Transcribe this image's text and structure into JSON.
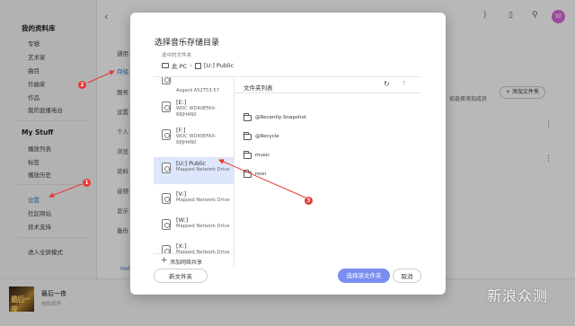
{
  "sidebar": {
    "library_heading": "我的资料库",
    "library_items": [
      "专辑",
      "艺术家",
      "曲目",
      "作曲家",
      "作品",
      "我的直播电台"
    ],
    "mystuff_heading": "My Stuff",
    "mystuff_items": [
      "播放列表",
      "标签",
      "播放历史"
    ],
    "settings_label": "设置",
    "community_label": "社区网站",
    "support_label": "技术支持",
    "fullscreen_label": "进入全屏模式"
  },
  "player": {
    "track_title": "最后一夜",
    "track_subtitle": "电影原声",
    "album_art_text": "最后一夜"
  },
  "background": {
    "general_label": "通用",
    "storage_label": "存储",
    "items": [
      "服务",
      "设置",
      "个人",
      "浏览",
      "资料",
      "音频",
      "显示",
      "备份"
    ],
    "hint_text": "如选择添加成员",
    "add_folder_button": "+ 添加文件夹",
    "home_link": "Hel"
  },
  "dialog": {
    "title": "选择音乐存储目录",
    "selected_label": "选中的文件夹",
    "path": {
      "root": "此 PC",
      "current": "[U:] Public"
    },
    "drives": [
      {
        "name": "",
        "desc": "Asgard AS2T53-57",
        "selected": false
      },
      {
        "name": "[E:]",
        "desc": "WDC WD40EFAX-68JH4N0",
        "selected": false
      },
      {
        "name": "[F:]",
        "desc": "WDC WD40EFAX-68JH4N0",
        "selected": false
      },
      {
        "name": "[U:] Public",
        "desc": "Mapped Network Drive",
        "selected": true
      },
      {
        "name": "[V:]",
        "desc": "Mapped Network Drive",
        "selected": false
      },
      {
        "name": "[W:]",
        "desc": "Mapped Network Drive",
        "selected": false
      },
      {
        "name": "[X:]",
        "desc": "Mapped Network Drive",
        "selected": false
      }
    ],
    "add_share_label": "添加网络共享",
    "folder_list_title": "文件夹列表",
    "folders": [
      "@Recently-Snapshot",
      "@Recycle",
      "music",
      "roon"
    ],
    "new_folder_button": "新文件夹",
    "confirm_button": "选择该文件夹",
    "cancel_button": "取消"
  },
  "annotations": [
    "1",
    "2",
    "3"
  ],
  "watermark": "新浪众测",
  "colors": {
    "accent": "#3a7bd5",
    "primary_button": "#7b8ef0",
    "selection": "#dde6fb",
    "annotation": "#e53935",
    "avatar": "#d96ad9"
  },
  "icons": [
    "back-icon",
    "computer-icon",
    "drive-icon",
    "folder-icon",
    "refresh-icon",
    "up-icon",
    "search-icon",
    "bookmark-icon",
    "avatar"
  ]
}
